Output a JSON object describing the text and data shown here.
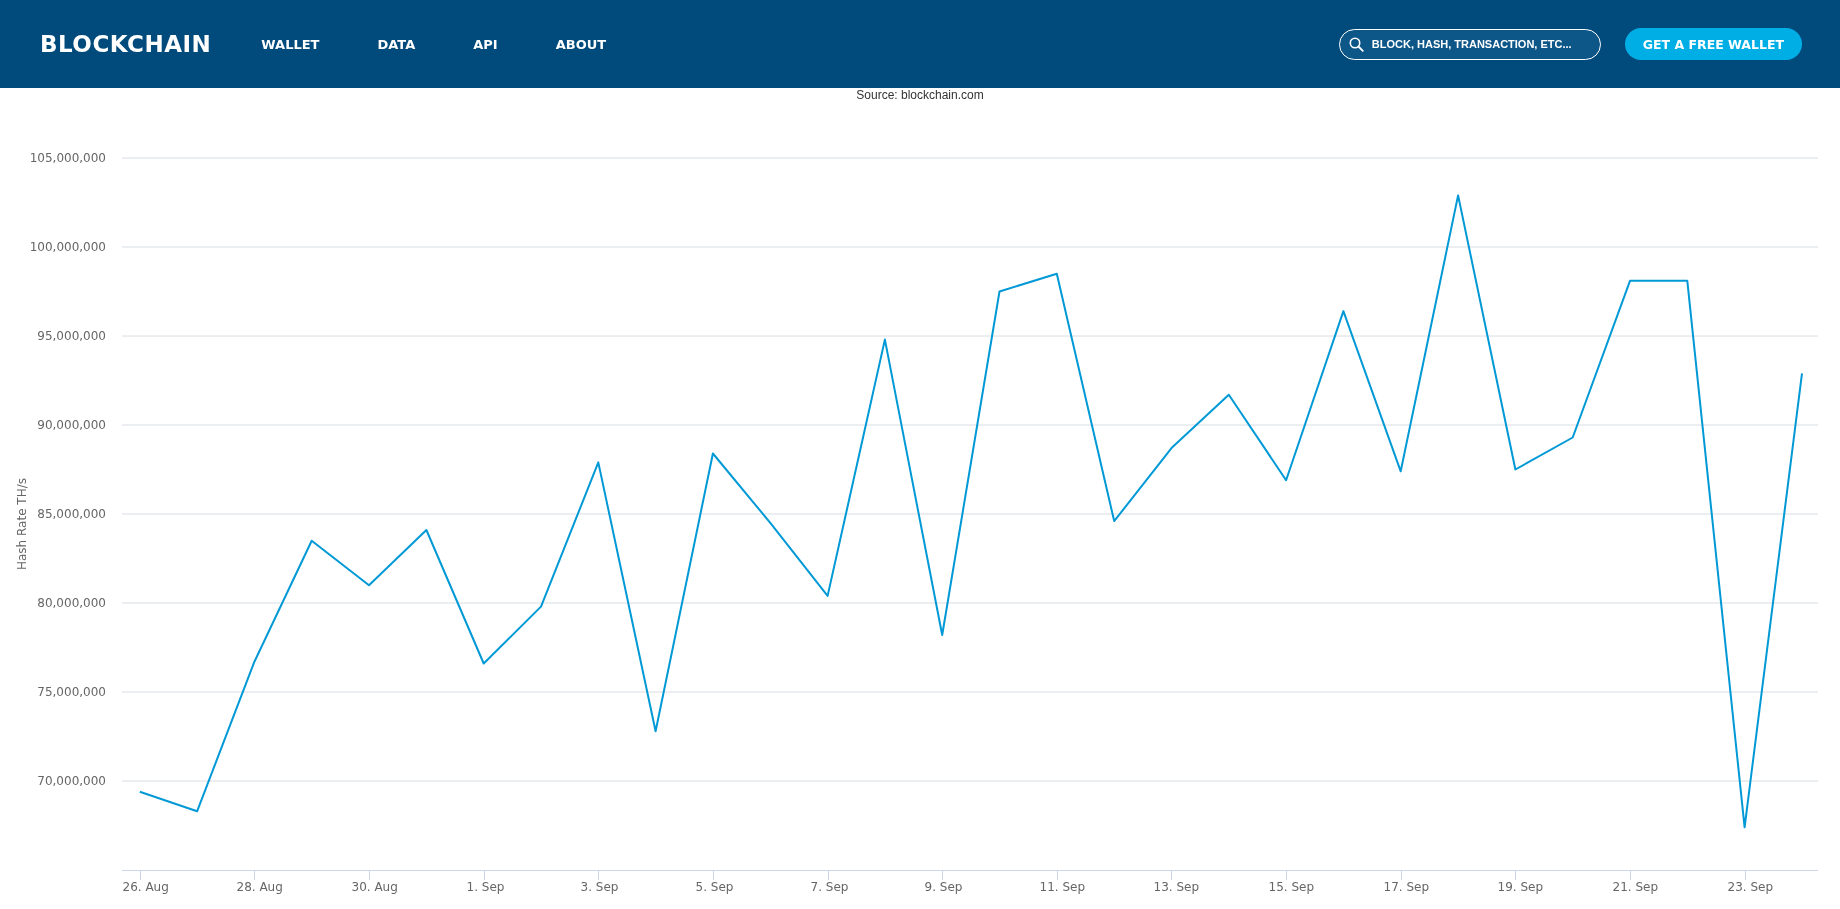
{
  "header": {
    "logo": "BLOCKCHAIN",
    "nav": [
      {
        "label": "WALLET"
      },
      {
        "label": "DATA"
      },
      {
        "label": "API"
      },
      {
        "label": "ABOUT"
      }
    ],
    "search": {
      "placeholder": "BLOCK, HASH, TRANSACTION, ETC..."
    },
    "button": "GET A FREE WALLET"
  },
  "source": "Source: blockchain.com",
  "chart_data": {
    "type": "line",
    "ylabel": "Hash Rate TH/s",
    "categories": [
      "26. Aug",
      null,
      "28. Aug",
      null,
      "30. Aug",
      null,
      "1. Sep",
      null,
      "3. Sep",
      null,
      "5. Sep",
      null,
      "7. Sep",
      null,
      "9. Sep",
      null,
      "11. Sep",
      null,
      "13. Sep",
      null,
      "15. Sep",
      null,
      "17. Sep",
      null,
      "19. Sep",
      null,
      "21. Sep",
      null,
      "23. Sep",
      null
    ],
    "series": [
      {
        "color": "#0099d6",
        "values": [
          69400000,
          68300000,
          76700000,
          83500000,
          81000000,
          84100000,
          76600000,
          79800000,
          87900000,
          72800000,
          88400000,
          84500000,
          80400000,
          94800000,
          78200000,
          97500000,
          98500000,
          84600000,
          88700000,
          91700000,
          86900000,
          96400000,
          87400000,
          102900000,
          87500000,
          89300000,
          98100000,
          98100000,
          67400000,
          92900000
        ]
      }
    ],
    "grid": true,
    "ylim": [
      65000000,
      105000000
    ],
    "yticks": [
      {
        "value": 70000000,
        "label": "70,000,000"
      },
      {
        "value": 75000000,
        "label": "75,000,000"
      },
      {
        "value": 80000000,
        "label": "80,000,000"
      },
      {
        "value": 85000000,
        "label": "85,000,000"
      },
      {
        "value": 90000000,
        "label": "90,000,000"
      },
      {
        "value": 95000000,
        "label": "95,000,000"
      },
      {
        "value": 100000000,
        "label": "100,000,000"
      },
      {
        "value": 105000000,
        "label": "105,000,000"
      }
    ]
  }
}
